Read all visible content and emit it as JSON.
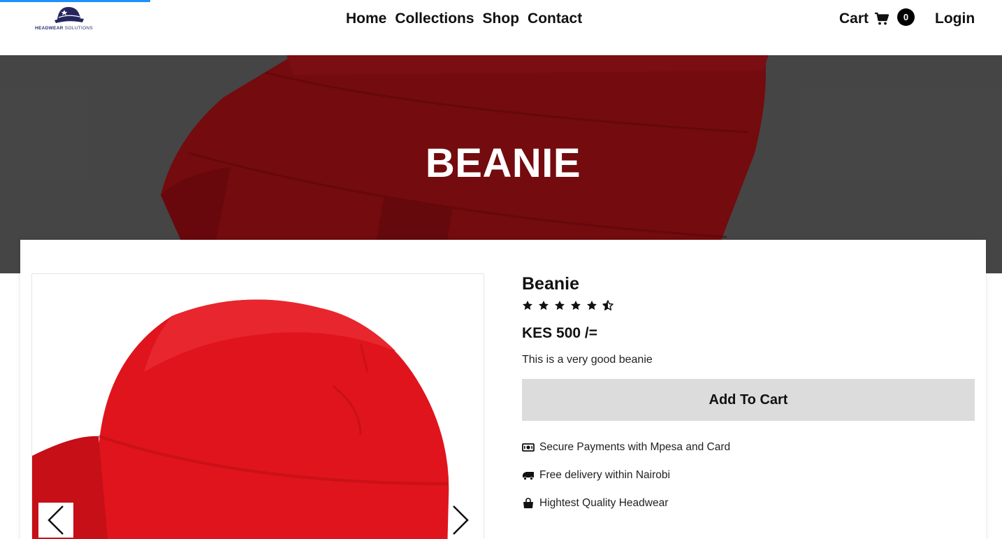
{
  "header": {
    "logo_text_bold": "HEADWEAR",
    "logo_text_light": "SOLUTIONS",
    "nav": [
      {
        "label": "Home"
      },
      {
        "label": "Collections"
      },
      {
        "label": "Shop"
      },
      {
        "label": "Contact"
      }
    ],
    "cart_label": "Cart",
    "cart_count": "0",
    "login_label": "Login"
  },
  "hero": {
    "title": "BEANIE"
  },
  "product": {
    "name": "Beanie",
    "rating": 4.5,
    "rating_max": 5,
    "price": "KES 500 /=",
    "description": "This is a very good beanie",
    "add_to_cart_label": "Add To Cart",
    "features": [
      {
        "icon": "money-bill-icon",
        "text": "Secure Payments with Mpesa and Card"
      },
      {
        "icon": "truck-icon",
        "text": "Free delivery within Nairobi"
      },
      {
        "icon": "shopping-bag-icon",
        "text": "Hightest Quality Headwear"
      }
    ]
  },
  "colors": {
    "accent_progress": "#1e90ff",
    "product_red": "#e0141c",
    "button_bg": "#dcdcdc"
  },
  "page_loading_progress_percent": 15
}
